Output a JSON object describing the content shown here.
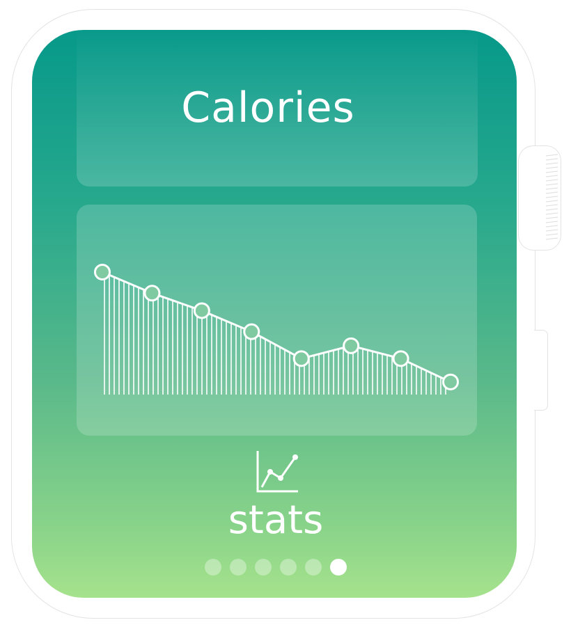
{
  "screen": {
    "title": "Calories",
    "stats_label": "stats",
    "stats_icon": "line-chart-icon",
    "page_count": 6,
    "active_page": 6
  },
  "colors": {
    "gradient_top": "#07998a",
    "gradient_bottom": "#a6e28c",
    "marker_fill": "#7fcaa0",
    "line": "#ffffff"
  },
  "chart_data": {
    "type": "line",
    "x": [
      1,
      2,
      3,
      4,
      5,
      6,
      7,
      8
    ],
    "series": [
      {
        "values": [
          100,
          82,
          67,
          49,
          26,
          37,
          26,
          6
        ]
      }
    ],
    "ylim": [
      0,
      100
    ],
    "grid": false,
    "fill": "vertical-hatch"
  }
}
